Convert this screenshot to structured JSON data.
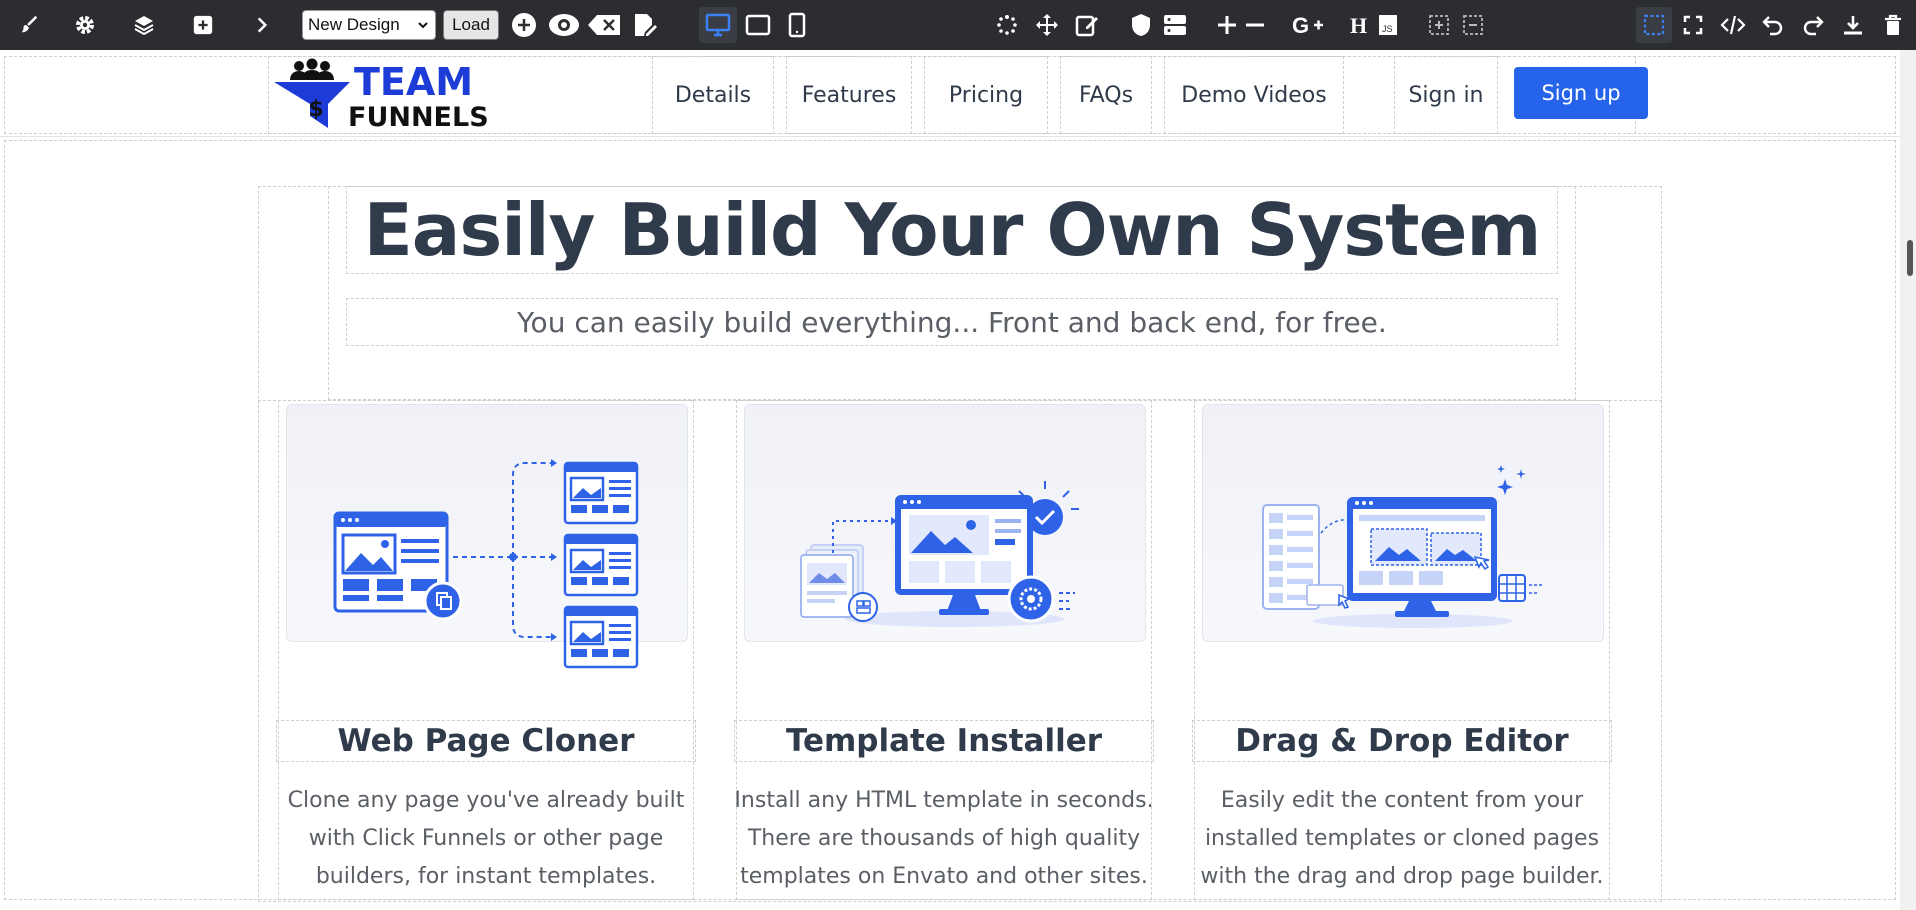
{
  "toolbar": {
    "design_select_value": "New Design",
    "load_label": "Load",
    "icons": [
      "brush-icon",
      "settings-icon",
      "layers-icon",
      "add-block-icon",
      "chevron-right-icon",
      "add-circle-icon",
      "preview-eye-icon",
      "clear-icon",
      "edit-page-icon",
      "desktop-icon",
      "tablet-icon",
      "mobile-icon",
      "spinner-icon",
      "move-icon",
      "edit-icon",
      "shield-icon",
      "server-icon",
      "plus-icon",
      "minus-icon",
      "google-plus-icon",
      "heading-icon",
      "js-icon",
      "select-add-icon",
      "select-remove-icon",
      "select-box-icon",
      "fullscreen-icon",
      "code-icon",
      "undo-icon",
      "redo-icon",
      "download-icon",
      "trash-icon"
    ]
  },
  "header": {
    "logo": {
      "line1": "TEAM",
      "line2": "FUNNELS"
    },
    "nav": [
      "Details",
      "Features",
      "Pricing",
      "FAQs",
      "Demo Videos"
    ],
    "signin_label": "Sign in",
    "signup_label": "Sign up"
  },
  "hero": {
    "title": "Easily Build Your Own System",
    "subtitle": "You can easily build everything... Front and back end, for free."
  },
  "features": [
    {
      "title": "Web Page Cloner",
      "desc": [
        "Clone any page you've already built",
        "with Click Funnels or other page",
        "builders, for instant templates."
      ]
    },
    {
      "title": "Template Installer",
      "desc": [
        "Install any HTML template in seconds.",
        "There are thousands of high quality",
        "templates on Envato and other sites."
      ]
    },
    {
      "title": "Drag & Drop Editor",
      "desc": [
        "Easily edit the content from your",
        "installed templates or cloned pages",
        "with the drag and drop page builder."
      ]
    }
  ],
  "colors": {
    "accent": "#2563eb",
    "toolbar": "#2b2d31",
    "heading": "#2f3a4a",
    "body_text": "#5a5f66"
  }
}
